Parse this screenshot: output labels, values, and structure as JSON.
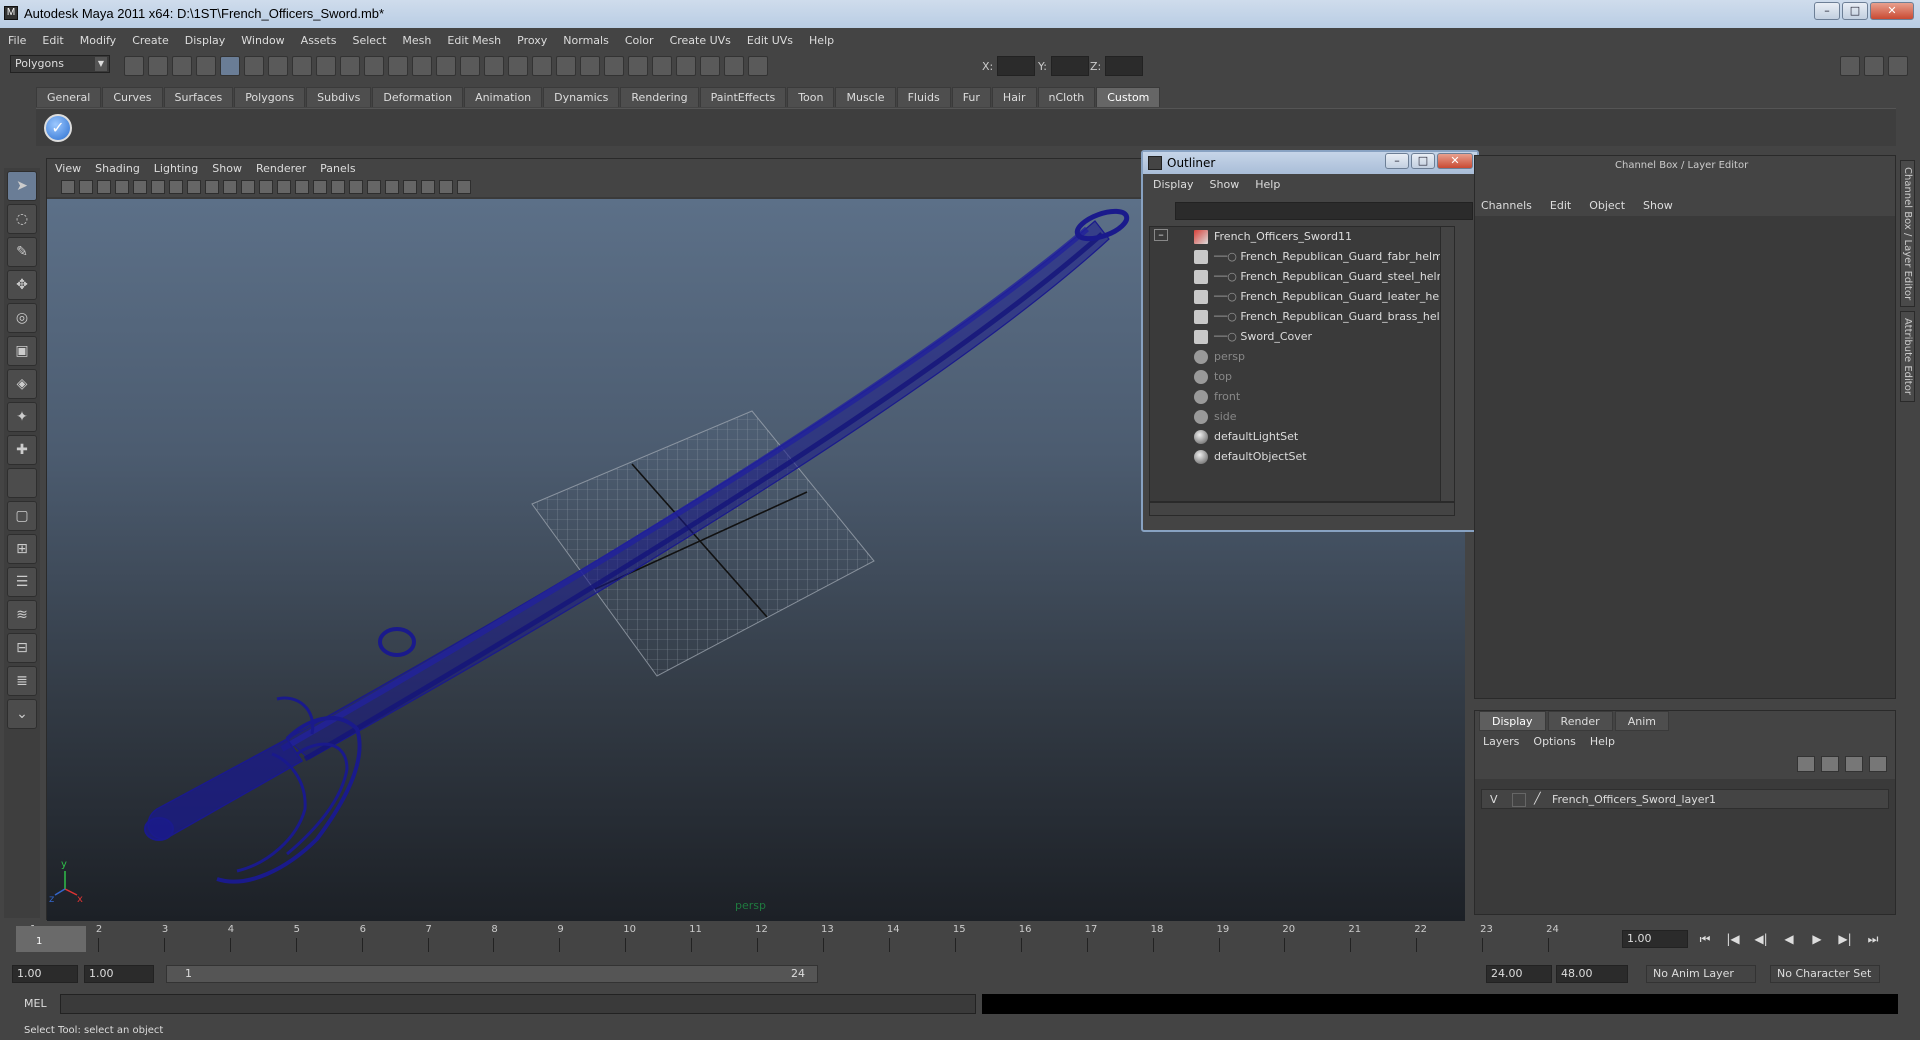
{
  "window": {
    "title": "Autodesk Maya 2011 x64: D:\\1ST\\French_Officers_Sword.mb*",
    "app_icon": "M",
    "minimize": "–",
    "maximize": "□",
    "close": "✕"
  },
  "menubar": [
    "File",
    "Edit",
    "Modify",
    "Create",
    "Display",
    "Window",
    "Assets",
    "Select",
    "Mesh",
    "Edit Mesh",
    "Proxy",
    "Normals",
    "Color",
    "Create UVs",
    "Edit UVs",
    "Help"
  ],
  "statusline": {
    "mode": "Polygons",
    "x_label": "X:",
    "y_label": "Y:",
    "z_label": "Z:"
  },
  "shelf": {
    "tabs": [
      "General",
      "Curves",
      "Surfaces",
      "Polygons",
      "Subdivs",
      "Deformation",
      "Animation",
      "Dynamics",
      "Rendering",
      "PaintEffects",
      "Toon",
      "Muscle",
      "Fluids",
      "Fur",
      "Hair",
      "nCloth",
      "Custom"
    ],
    "active_tab": "Custom",
    "check_icon": "✓"
  },
  "viewport": {
    "menu": [
      "View",
      "Shading",
      "Lighting",
      "Show",
      "Renderer",
      "Panels"
    ],
    "camera_label": "persp",
    "axis_y": "y",
    "axis_x": "x",
    "axis_z": "z",
    "wire_color": "#1a1a8c"
  },
  "outliner": {
    "title": "Outliner",
    "menu": [
      "Display",
      "Show",
      "Help"
    ],
    "expand": "–",
    "items": [
      {
        "label": "French_Officers_Sword11",
        "type": "group"
      },
      {
        "label": "French_Republican_Guard_fabr_helm",
        "type": "mesh"
      },
      {
        "label": "French_Republican_Guard_steel_helm",
        "type": "mesh"
      },
      {
        "label": "French_Republican_Guard_leater_helm",
        "type": "mesh"
      },
      {
        "label": "French_Republican_Guard_brass_helm",
        "type": "mesh"
      },
      {
        "label": "Sword_Cover",
        "type": "mesh"
      },
      {
        "label": "persp",
        "type": "camera"
      },
      {
        "label": "top",
        "type": "camera"
      },
      {
        "label": "front",
        "type": "camera"
      },
      {
        "label": "side",
        "type": "camera"
      },
      {
        "label": "defaultLightSet",
        "type": "set"
      },
      {
        "label": "defaultObjectSet",
        "type": "set"
      }
    ]
  },
  "channelbox": {
    "title": "Channel Box / Layer Editor",
    "menu": [
      "Channels",
      "Edit",
      "Object",
      "Show"
    ],
    "side_tabs": [
      "Channel Box / Layer Editor",
      "Attribute Editor"
    ]
  },
  "layer_editor": {
    "tabs": [
      "Display",
      "Render",
      "Anim"
    ],
    "active_tab": "Display",
    "menu": [
      "Layers",
      "Options",
      "Help"
    ],
    "layer": {
      "visible": "V",
      "name": "French_Officers_Sword_layer1"
    }
  },
  "timeslider": {
    "ticks": [
      "1",
      "2",
      "3",
      "4",
      "5",
      "6",
      "7",
      "8",
      "9",
      "10",
      "11",
      "12",
      "13",
      "14",
      "15",
      "16",
      "17",
      "18",
      "19",
      "20",
      "21",
      "22",
      "23",
      "24"
    ],
    "current": "1",
    "current_frame": "1.00",
    "playback_icons": [
      "⏮",
      "|◀",
      "◀|",
      "◀",
      "▶",
      "▶|",
      "⏭"
    ]
  },
  "rangeslider": {
    "start_time": "1.00",
    "playback_start": "1.00",
    "range_start": "1",
    "range_end": "24",
    "playback_end": "24.00",
    "end_time": "48.00",
    "anim_layer": "No Anim Layer",
    "character_set": "No Character Set"
  },
  "cmdline": {
    "label": "MEL",
    "help": "Select Tool: select an object"
  }
}
